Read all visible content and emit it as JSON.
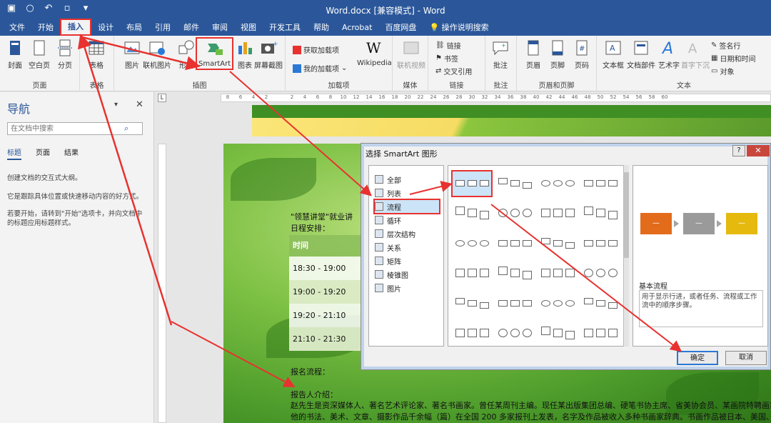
{
  "window": {
    "title": "Word.docx [兼容模式]  -  Word"
  },
  "tabs": [
    {
      "label": "文件",
      "active": false
    },
    {
      "label": "开始",
      "active": false
    },
    {
      "label": "插入",
      "active": true
    },
    {
      "label": "设计",
      "active": false
    },
    {
      "label": "布局",
      "active": false
    },
    {
      "label": "引用",
      "active": false
    },
    {
      "label": "邮件",
      "active": false
    },
    {
      "label": "审阅",
      "active": false
    },
    {
      "label": "视图",
      "active": false
    },
    {
      "label": "开发工具",
      "active": false
    },
    {
      "label": "帮助",
      "active": false
    },
    {
      "label": "Acrobat",
      "active": false
    },
    {
      "label": "百度网盘",
      "active": false
    },
    {
      "label": "操作说明搜索",
      "active": false
    }
  ],
  "ribbon": {
    "pages": {
      "label": "页面",
      "cover": "封面",
      "blank": "空白页",
      "break": "分页"
    },
    "table": {
      "label": "表格",
      "table": "表格"
    },
    "illustrations": {
      "label": "插图",
      "picture": "图片",
      "online_picture": "联机图片",
      "shapes": "形状",
      "smartart": "SmartArt",
      "chart": "图表",
      "screenshot": "屏幕截图"
    },
    "addins": {
      "label": "加载项",
      "get": "获取加载项",
      "my": "我的加载项",
      "wikipedia": "Wikipedia"
    },
    "media": {
      "label": "媒体",
      "video": "联机视频"
    },
    "links": {
      "label": "链接",
      "link": "链接",
      "bookmark": "书签",
      "crossref": "交叉引用"
    },
    "comments": {
      "label": "批注",
      "comment": "批注"
    },
    "headerfooter": {
      "label": "页眉和页脚",
      "header": "页眉",
      "footer": "页脚",
      "pagenum": "页码"
    },
    "text": {
      "label": "文本",
      "textbox": "文本框",
      "parts": "文档部件",
      "wordart": "艺术字",
      "dropcap": "首字下沉",
      "signature": "签名行",
      "datetime": "日期和时间",
      "object": "对象"
    }
  },
  "navigation": {
    "title": "导航",
    "search_placeholder": "在文档中搜索",
    "tabs": [
      "标题",
      "页面",
      "结果"
    ],
    "text1": "创建文档的交互式大纲。",
    "text2": "它是跟踪具体位置或快速移动内容的好方式。",
    "text3": "若要开始，请转到\"开始\"选项卡，并向文档中的标题应用标题样式。"
  },
  "ruler_marks": [
    "8",
    "6",
    "4",
    "2",
    "",
    "2",
    "4",
    "6",
    "8",
    "10",
    "12",
    "14",
    "16",
    "18",
    "20",
    "22",
    "24",
    "26",
    "28",
    "30",
    "32",
    "34",
    "36",
    "38",
    "40",
    "42",
    "44",
    "46",
    "48",
    "50",
    "52",
    "54",
    "56",
    "58",
    "60"
  ],
  "document": {
    "line1": "\"领慧讲堂\"就业讲",
    "line2": "日程安排：",
    "schedule_header": "时间",
    "schedule": [
      "18:30 - 19:00",
      "19:00 - 19:20",
      "19:20 - 21:10",
      "21:10 - 21:30"
    ],
    "signup": "报名流程：",
    "reporter": "报告人介绍：",
    "bio1": "赵先生是资深媒体人、著名艺术评论家、著名书画家。曾任某周刊主编。现任某出版集团总编、硬笔书协主席、省美协会员、某画院特聘画家",
    "bio2": "他的书法、美术、文章、摄影作品千余幅（篇）在全国 200 多家报刊上发表，名字及作品被收入多种书画家辞典。书画作品被日本、美国、"
  },
  "dialog": {
    "title": "选择 SmartArt 图形",
    "help": "?",
    "close": "✕",
    "categories": [
      {
        "label": "全部",
        "selected": false
      },
      {
        "label": "列表",
        "selected": false
      },
      {
        "label": "流程",
        "selected": true
      },
      {
        "label": "循环",
        "selected": false
      },
      {
        "label": "层次结构",
        "selected": false
      },
      {
        "label": "关系",
        "selected": false
      },
      {
        "label": "矩阵",
        "selected": false
      },
      {
        "label": "棱锥图",
        "selected": false
      },
      {
        "label": "图片",
        "selected": false
      }
    ],
    "preview_name": "基本流程",
    "preview_desc": "用于显示行进，或者任务、流程或工作流中的顺序步骤。",
    "preview_box_text": "—",
    "preview_colors": [
      "#e36c1c",
      "#9a9a9a",
      "#e6b90e"
    ],
    "ok": "确定",
    "cancel": "取消"
  },
  "colors": {
    "accent": "#2b579a",
    "annotation": "#e8322f"
  }
}
